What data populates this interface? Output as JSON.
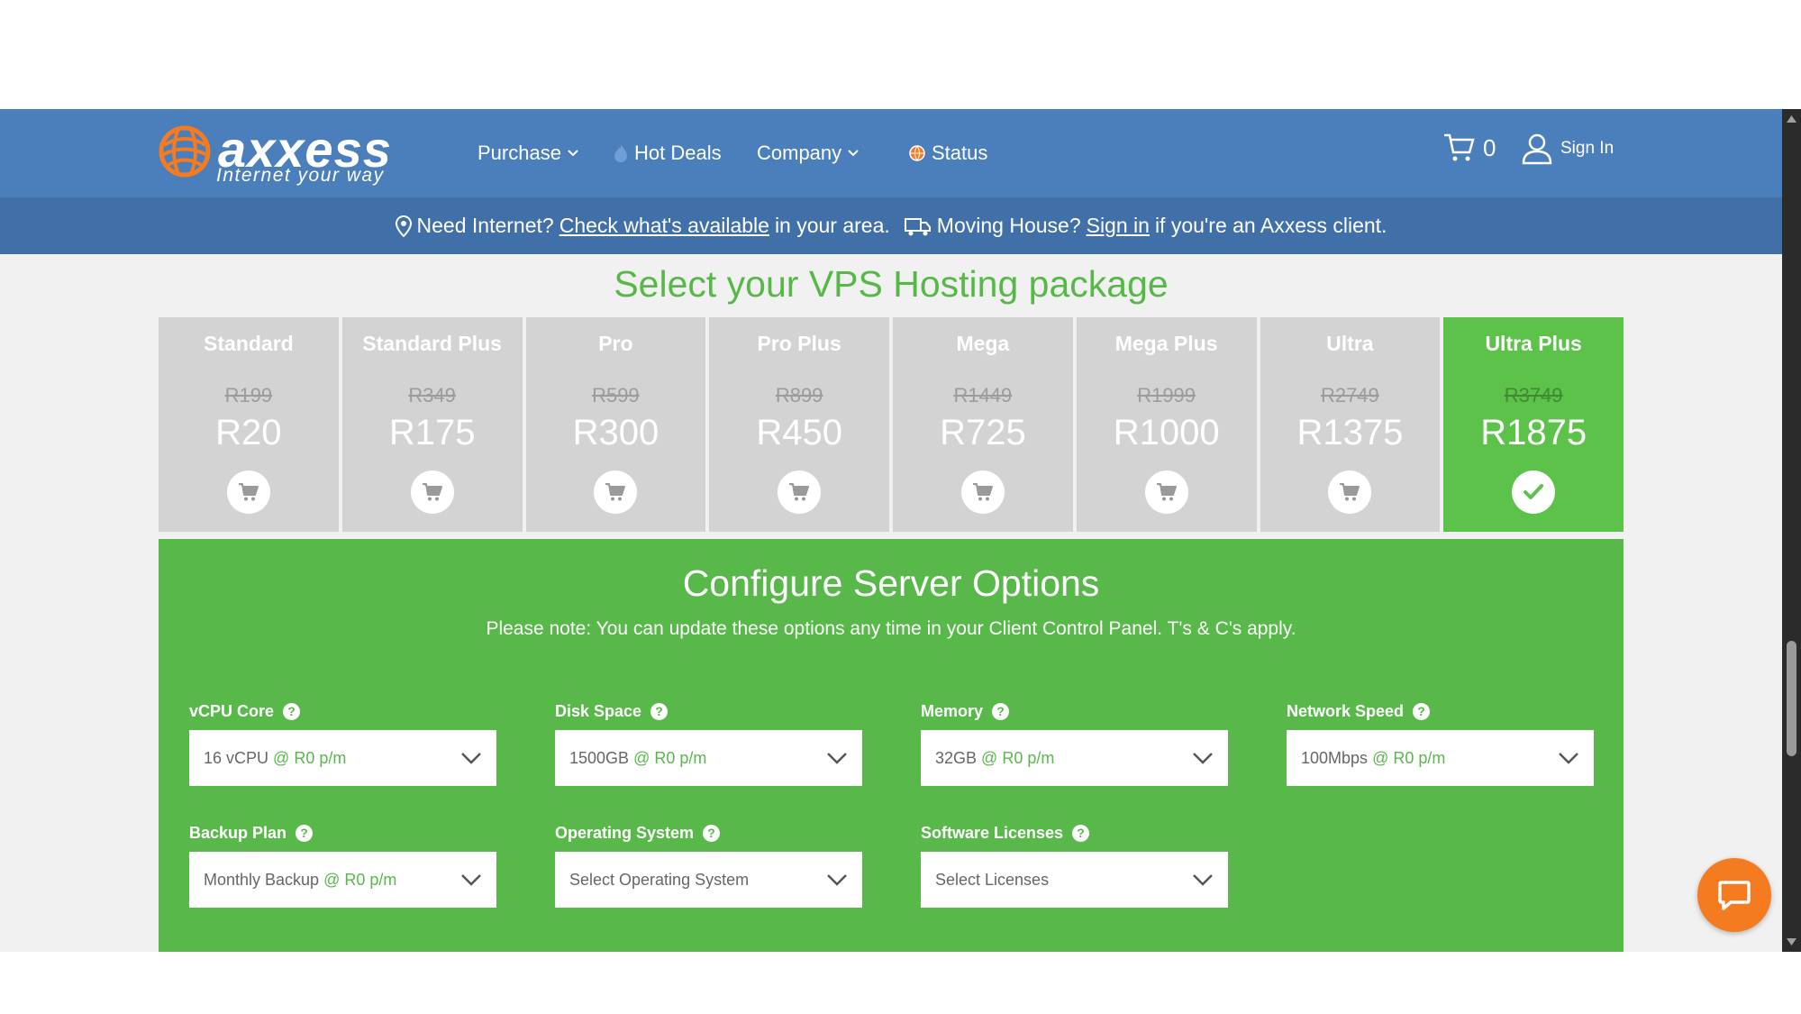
{
  "header": {
    "logo_word": "axxess",
    "logo_tagline": "Internet your way",
    "nav": {
      "purchase": "Purchase",
      "hot_deals": "Hot Deals",
      "company": "Company",
      "status": "Status"
    },
    "cart_count": "0",
    "sign_in": "Sign In"
  },
  "info_bar": {
    "need_internet": "Need Internet?",
    "check_link": "Check what's available",
    "in_area": "in your area.",
    "moving": "Moving House?",
    "sign_in_link": "Sign in",
    "client_text": "if you're an Axxess client."
  },
  "heading": "Select your VPS Hosting package",
  "packages": [
    {
      "name": "Standard",
      "old_price": "R199",
      "price": "R20",
      "selected": false
    },
    {
      "name": "Standard Plus",
      "old_price": "R349",
      "price": "R175",
      "selected": false
    },
    {
      "name": "Pro",
      "old_price": "R599",
      "price": "R300",
      "selected": false
    },
    {
      "name": "Pro Plus",
      "old_price": "R899",
      "price": "R450",
      "selected": false
    },
    {
      "name": "Mega",
      "old_price": "R1449",
      "price": "R725",
      "selected": false
    },
    {
      "name": "Mega Plus",
      "old_price": "R1999",
      "price": "R1000",
      "selected": false
    },
    {
      "name": "Ultra",
      "old_price": "R2749",
      "price": "R1375",
      "selected": false
    },
    {
      "name": "Ultra Plus",
      "old_price": "R3749",
      "price": "R1875",
      "selected": true
    }
  ],
  "config": {
    "title": "Configure Server Options",
    "note": "Please note: You can update these options any time in your Client Control Panel. T's & C's apply.",
    "fields": {
      "vcpu": {
        "label": "vCPU Core",
        "value": "16 vCPU",
        "rate": "@ R0 p/m"
      },
      "disk": {
        "label": "Disk Space",
        "value": "1500GB",
        "rate": "@ R0 p/m"
      },
      "memory": {
        "label": "Memory",
        "value": "32GB",
        "rate": "@ R0 p/m"
      },
      "network": {
        "label": "Network Speed",
        "value": "100Mbps",
        "rate": "@ R0 p/m"
      },
      "backup": {
        "label": "Backup Plan",
        "value": "Monthly Backup",
        "rate": "@ R0 p/m"
      },
      "os": {
        "label": "Operating System",
        "placeholder": "Select Operating System"
      },
      "licenses": {
        "label": "Software Licenses",
        "placeholder": "Select Licenses"
      }
    },
    "help_glyph": "?"
  },
  "colors": {
    "nav_blue": "#4a7fbb",
    "info_blue": "#4170a9",
    "brand_green": "#58b84a",
    "selected_green": "#5cc24a",
    "tile_grey": "#d3d3d3",
    "chat_orange": "#f47b20"
  }
}
